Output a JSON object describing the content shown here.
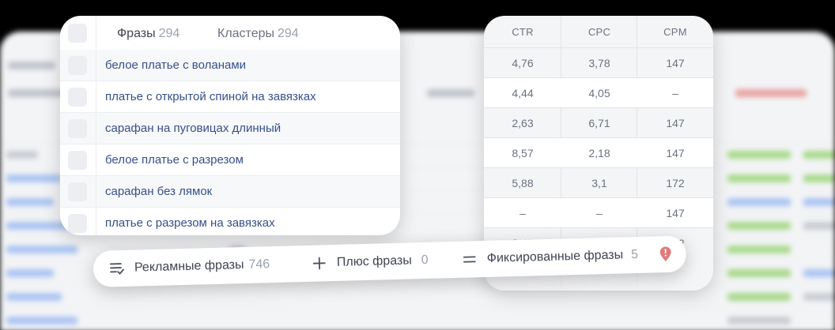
{
  "phrases_card": {
    "tabs": [
      {
        "label": "Фразы",
        "count": "294"
      },
      {
        "label": "Кластеры",
        "count": "294"
      }
    ],
    "rows": [
      "белое платье с воланами",
      "платье с открытой спиной на завязках",
      "сарафан на пуговицах длинный",
      "белое платье с разрезом",
      "сарафан без лямок",
      "платье с разрезом на завязках"
    ]
  },
  "metrics_card": {
    "headers": [
      "CTR",
      "CPC",
      "CPM"
    ],
    "rows": [
      [
        "4,76",
        "3,78",
        "147"
      ],
      [
        "4,44",
        "4,05",
        "–"
      ],
      [
        "2,63",
        "6,71",
        "147"
      ],
      [
        "8,57",
        "2,18",
        "147"
      ],
      [
        "5,88",
        "3,1",
        "172"
      ],
      [
        "–",
        "–",
        "147"
      ],
      [
        "3,45",
        "5,16",
        "172"
      ]
    ]
  },
  "bottom_bar": {
    "ad_phrases": {
      "label": "Рекламные фразы",
      "count": "746"
    },
    "plus_phrases": {
      "label": "Плюс фразы",
      "count": "0"
    },
    "fixed_phrases": {
      "label": "Фиксированные фразы",
      "count": "5"
    }
  },
  "colors": {
    "accent": "#3b66d6",
    "phrase_text": "#35508a",
    "alert_red": "#e05a5a"
  },
  "icons": [
    "list-settings-icon",
    "plus-icon",
    "equals-icon",
    "pin-alert-icon"
  ]
}
